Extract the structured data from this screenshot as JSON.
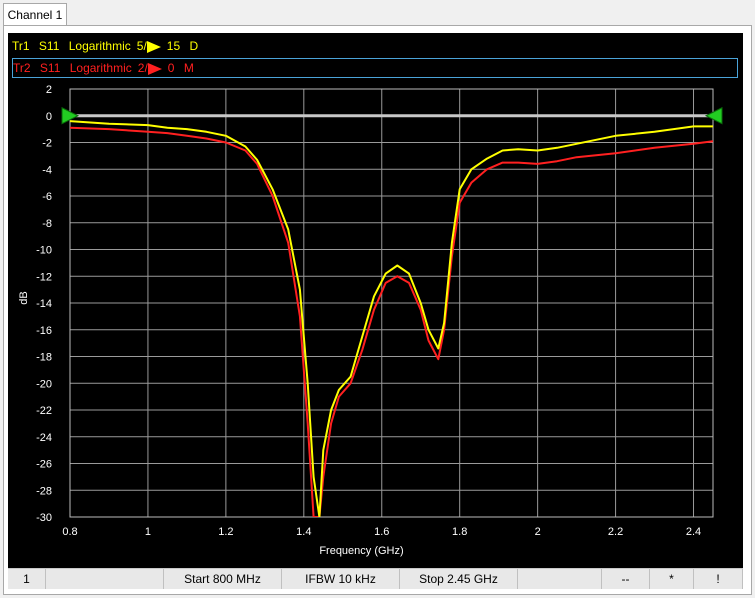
{
  "tab": {
    "label": "Channel 1"
  },
  "traces": [
    {
      "id": "Tr1",
      "param": "S11",
      "format": "Logarithmic",
      "scale": "5",
      "ref_symbol": "/",
      "ref_value": "15",
      "unit": "D",
      "color": "#ffff00"
    },
    {
      "id": "Tr2",
      "param": "S11",
      "format": "Logarithmic",
      "scale": "2",
      "ref_symbol": "/",
      "ref_value": "0",
      "unit": "M",
      "color": "#ff2020"
    }
  ],
  "status_bar": {
    "channel": "1",
    "start": "Start 800 MHz",
    "ifbw": "IFBW 10 kHz",
    "stop": "Stop 2.45 GHz",
    "field_a": "--",
    "field_b": "*",
    "field_c": "!"
  },
  "chart_data": {
    "type": "line",
    "xlabel": "Frequency (GHz)",
    "ylabel": "dB",
    "xlim": [
      0.8,
      2.45
    ],
    "ylim": [
      -30,
      2
    ],
    "x_ticks": [
      0.8,
      1,
      1.2,
      1.4,
      1.6,
      1.8,
      2,
      2.2,
      2.4
    ],
    "y_ticks": [
      2,
      0,
      -2,
      -4,
      -6,
      -8,
      -10,
      -12,
      -14,
      -16,
      -18,
      -20,
      -22,
      -24,
      -26,
      -28,
      -30
    ],
    "grid": true,
    "reference_level": 0,
    "series": [
      {
        "name": "Tr1",
        "color": "#ffff00",
        "x": [
          0.8,
          0.9,
          1.0,
          1.05,
          1.1,
          1.15,
          1.2,
          1.25,
          1.28,
          1.32,
          1.36,
          1.39,
          1.41,
          1.425,
          1.44,
          1.45,
          1.47,
          1.49,
          1.52,
          1.55,
          1.58,
          1.61,
          1.64,
          1.67,
          1.7,
          1.72,
          1.745,
          1.76,
          1.78,
          1.8,
          1.83,
          1.87,
          1.91,
          1.95,
          2.0,
          2.05,
          2.1,
          2.2,
          2.3,
          2.4,
          2.45
        ],
        "y": [
          -0.4,
          -0.6,
          -0.7,
          -0.9,
          -1.0,
          -1.2,
          -1.5,
          -2.3,
          -3.3,
          -5.5,
          -8.5,
          -13,
          -20,
          -27,
          -30,
          -25,
          -22,
          -20.5,
          -19.5,
          -16.5,
          -13.5,
          -11.8,
          -11.2,
          -11.8,
          -14.0,
          -16.0,
          -17.4,
          -15.5,
          -9.5,
          -5.5,
          -4.0,
          -3.2,
          -2.6,
          -2.5,
          -2.6,
          -2.4,
          -2.1,
          -1.5,
          -1.2,
          -0.8,
          -0.8
        ]
      },
      {
        "name": "Tr2",
        "color": "#ff2020",
        "x": [
          0.8,
          0.9,
          1.0,
          1.05,
          1.1,
          1.15,
          1.2,
          1.25,
          1.28,
          1.32,
          1.36,
          1.39,
          1.41,
          1.425,
          1.44,
          1.45,
          1.47,
          1.49,
          1.52,
          1.55,
          1.58,
          1.61,
          1.64,
          1.67,
          1.7,
          1.72,
          1.745,
          1.76,
          1.78,
          1.8,
          1.83,
          1.87,
          1.91,
          1.95,
          2.0,
          2.05,
          2.1,
          2.2,
          2.3,
          2.4,
          2.45
        ],
        "y": [
          -0.9,
          -1.0,
          -1.2,
          -1.3,
          -1.5,
          -1.7,
          -2.0,
          -2.6,
          -3.6,
          -6.0,
          -9.5,
          -15,
          -23,
          -30,
          -30,
          -27,
          -23,
          -21,
          -20,
          -17.5,
          -14.5,
          -12.5,
          -12.0,
          -12.5,
          -14.5,
          -16.8,
          -18.2,
          -16.0,
          -10.5,
          -6.5,
          -5.0,
          -4.0,
          -3.5,
          -3.5,
          -3.6,
          -3.4,
          -3.1,
          -2.8,
          -2.4,
          -2.1,
          -1.9
        ]
      }
    ]
  }
}
